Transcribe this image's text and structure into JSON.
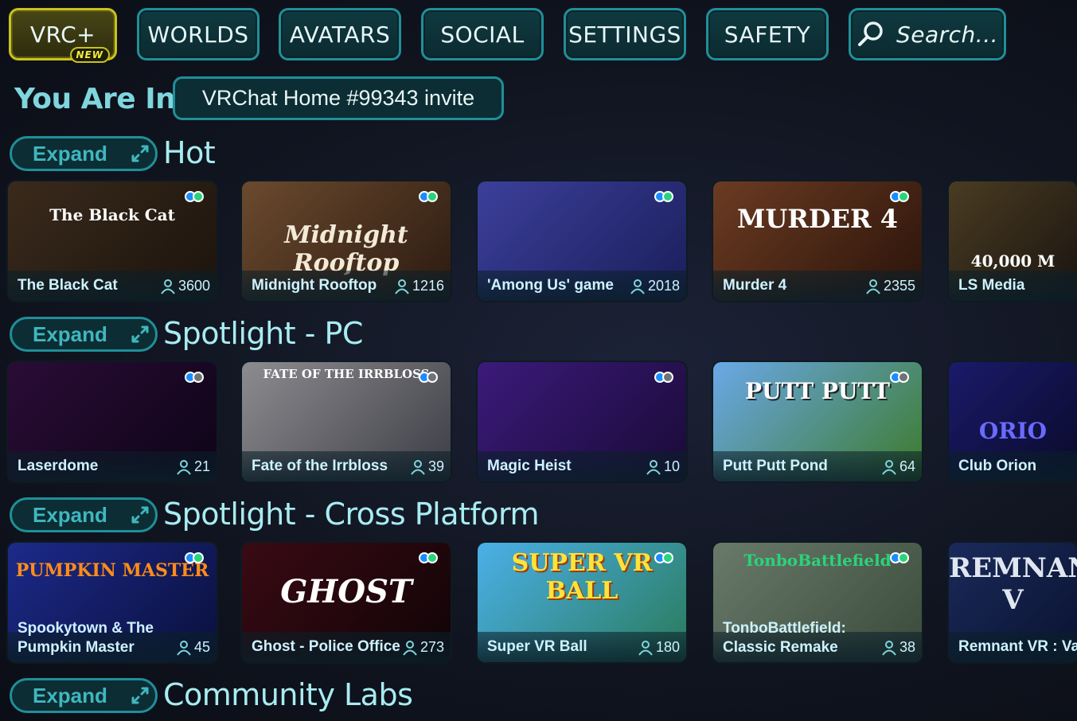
{
  "nav": {
    "vrc_plus": "VRC+",
    "new_badge": "NEW",
    "worlds": "WORLDS",
    "avatars": "AVATARS",
    "social": "SOCIAL",
    "settings": "SETTINGS",
    "safety": "SAFETY",
    "search_placeholder": "Search..."
  },
  "location": {
    "label": "You Are In",
    "value": "VRChat Home #99343 invite"
  },
  "expand_label": "Expand",
  "colors": {
    "accent": "#1f8f99",
    "title": "#a8ecf1",
    "vrc_plus": "#c9c21c"
  },
  "sections": [
    {
      "title": "Hot",
      "cards": [
        {
          "name": "The Black Cat",
          "count": "3600",
          "thumb_text": "The Black Cat",
          "platform": "both"
        },
        {
          "name": "Midnight Rooftop",
          "count": "1216",
          "thumb_text": "Midnight Rooftop",
          "platform": "both"
        },
        {
          "name": "'Among Us' game",
          "count": "2018",
          "thumb_text": "",
          "platform": "both"
        },
        {
          "name": "Murder 4",
          "count": "2355",
          "thumb_text": "MURDER 4",
          "platform": "both"
        },
        {
          "name": "LS Media",
          "count": "",
          "thumb_text": "40,000 M",
          "platform": ""
        }
      ]
    },
    {
      "title": "Spotlight - PC",
      "cards": [
        {
          "name": "Laserdome",
          "count": "21",
          "thumb_text": "",
          "platform": "pc"
        },
        {
          "name": "Fate of the Irrbloss",
          "count": "39",
          "thumb_text": "FATE OF THE IRRBLOSS",
          "platform": "pc"
        },
        {
          "name": "Magic Heist",
          "count": "10",
          "thumb_text": "",
          "platform": "pc"
        },
        {
          "name": "Putt Putt Pond",
          "count": "64",
          "thumb_text": "PUTT PUTT",
          "platform": "pc"
        },
        {
          "name": "Club Orion",
          "count": "",
          "thumb_text": "ORIO",
          "platform": ""
        }
      ]
    },
    {
      "title": "Spotlight - Cross Platform",
      "cards": [
        {
          "name": "Spookytown & The\nPumpkin Master",
          "count": "45",
          "thumb_text": "PUMPKIN MASTER",
          "platform": "both"
        },
        {
          "name": "Ghost - Police Office",
          "count": "273",
          "thumb_text": "GHOST",
          "platform": "both"
        },
        {
          "name": "Super VR Ball",
          "count": "180",
          "thumb_text": "SUPER VR BALL",
          "platform": "both"
        },
        {
          "name": "TonboBattlefield:\nClassic Remake",
          "count": "38",
          "thumb_text": "TonboBattlefield",
          "platform": "both"
        },
        {
          "name": "Remnant VR : Va",
          "count": "",
          "thumb_text": "REMNANT V",
          "platform": ""
        }
      ]
    },
    {
      "title": "Community Labs",
      "cards": []
    }
  ]
}
